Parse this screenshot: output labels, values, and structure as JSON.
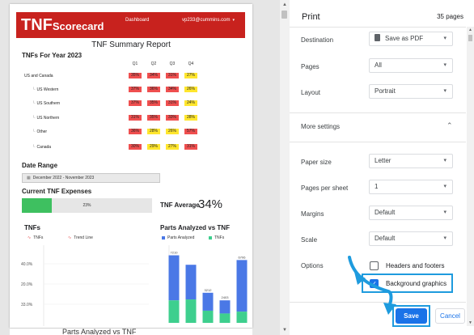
{
  "preview": {
    "app_title": {
      "main": "TNF",
      "rest": "Scorecard"
    },
    "nav_link": "Dashboard",
    "user": "vp233@cummins.com",
    "report_title": "TNF Summary Report",
    "tnfs_for_year": "TNFs For Year 2023",
    "quarters": [
      "Q1",
      "Q2",
      "Q3",
      "Q4"
    ],
    "regions": [
      {
        "name": "US and Canada",
        "child": false,
        "values": [
          {
            "text": "35%",
            "color": "red"
          },
          {
            "text": "34%",
            "color": "red"
          },
          {
            "text": "31%",
            "color": "red"
          },
          {
            "text": "27%",
            "color": "yellow"
          }
        ]
      },
      {
        "name": "US Western",
        "child": true,
        "values": [
          {
            "text": "37%",
            "color": "red"
          },
          {
            "text": "36%",
            "color": "red"
          },
          {
            "text": "34%",
            "color": "red"
          },
          {
            "text": "26%",
            "color": "yellow"
          }
        ]
      },
      {
        "name": "US Southern",
        "child": true,
        "values": [
          {
            "text": "37%",
            "color": "red"
          },
          {
            "text": "35%",
            "color": "red"
          },
          {
            "text": "31%",
            "color": "red"
          },
          {
            "text": "24%",
            "color": "yellow"
          }
        ]
      },
      {
        "name": "US Northern",
        "child": true,
        "values": [
          {
            "text": "31%",
            "color": "red"
          },
          {
            "text": "35%",
            "color": "red"
          },
          {
            "text": "33%",
            "color": "red"
          },
          {
            "text": "28%",
            "color": "yellow"
          }
        ]
      },
      {
        "name": "Other",
        "child": true,
        "values": [
          {
            "text": "36%",
            "color": "red"
          },
          {
            "text": "28%",
            "color": "yellow"
          },
          {
            "text": "26%",
            "color": "yellow"
          },
          {
            "text": "57%",
            "color": "red"
          }
        ]
      },
      {
        "name": "Canada",
        "child": true,
        "values": [
          {
            "text": "30%",
            "color": "red"
          },
          {
            "text": "29%",
            "color": "yellow"
          },
          {
            "text": "27%",
            "color": "yellow"
          },
          {
            "text": "31%",
            "color": "red"
          }
        ]
      }
    ],
    "date_range_label": "Date Range",
    "date_range_value": "December 2022 - November 2023",
    "current_expenses_label": "Current TNF Expenses",
    "expenses_progress_text": "23%",
    "expenses_progress_fraction": 0.23,
    "tnf_average_label": "TNF Average",
    "tnf_average_value": "34%",
    "tnfs_chart": {
      "title": "TNFs",
      "legend": [
        "TNFs",
        "Trend Line"
      ],
      "y_ticks": [
        "40.0%",
        "20.0%",
        "33.0%"
      ]
    },
    "parts_chart": {
      "title": "Parts Analyzed vs TNF",
      "legend": [
        "Parts Analyzed",
        "TNFs"
      ],
      "colors": {
        "parts": "#4a78e6",
        "tnfs": "#3ecf8e"
      },
      "bar_labels": [
        "7210",
        "",
        "3212",
        "2403",
        "6706"
      ],
      "parts": [
        7210,
        6200,
        3212,
        2403,
        6706
      ],
      "tnfs": [
        2400,
        2500,
        1300,
        1000,
        1200
      ]
    },
    "next_page_text": "Parts Analyzed vs TNF"
  },
  "panel": {
    "title": "Print",
    "page_count": "35 pages",
    "destination": {
      "label": "Destination",
      "value": "Save as PDF"
    },
    "pages": {
      "label": "Pages",
      "value": "All"
    },
    "layout": {
      "label": "Layout",
      "value": "Portrait"
    },
    "more_settings": "More settings",
    "paper_size": {
      "label": "Paper size",
      "value": "Letter"
    },
    "pages_per_sheet": {
      "label": "Pages per sheet",
      "value": "1"
    },
    "margins": {
      "label": "Margins",
      "value": "Default"
    },
    "scale": {
      "label": "Scale",
      "value": "Default"
    },
    "options": {
      "label": "Options",
      "headers_footers": {
        "label": "Headers and footers",
        "checked": false
      },
      "background_graphics": {
        "label": "Background graphics",
        "checked": true
      }
    },
    "save_label": "Save",
    "cancel_label": "Cancel"
  },
  "colors": {
    "brand_red": "#c8221e",
    "primary_blue": "#1a73e8",
    "annotation_blue": "#1e9bde",
    "cell_red": "#ef4f4f",
    "cell_yellow": "#ffe62e",
    "progress_green": "#3ec060"
  },
  "icons": [
    "chevron-down-icon",
    "chevron-up-icon",
    "pdf-file-icon",
    "check-icon",
    "calendar-icon",
    "annotation-arrow-icon"
  ]
}
